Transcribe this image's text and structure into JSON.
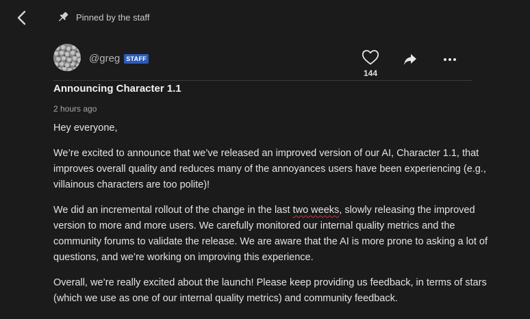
{
  "nav": {
    "back_icon": "chevron-left-icon"
  },
  "pinned": {
    "icon": "pin-icon",
    "label": "Pinned by the staff"
  },
  "author": {
    "username": "@greg",
    "badge": "STAFF"
  },
  "actions": {
    "like_count": "144",
    "like_icon": "heart-icon",
    "share_icon": "share-icon",
    "more_icon": "more-icon"
  },
  "post": {
    "title": "Announcing Character 1.1",
    "timestamp": "2 hours ago",
    "greeting": "Hey everyone,",
    "paragraph1": "We’re excited to announce that we’ve released an improved version of our AI, Character 1.1, that improves overall quality and reduces many of the annoyances users have been experiencing (e.g., villainous characters are too polite)!",
    "paragraph2_before": "We did an incremental rollout of the change in the last ",
    "paragraph2_highlight": "two weeks",
    "paragraph2_after": ", slowly releasing the improved version to more and more users. We carefully monitored our internal quality metrics and the community forums to validate the release. We are aware that the AI is more prone to asking a lot of questions, and we’re working on improving this experience.",
    "paragraph3": "Overall, we’re really excited about the launch! Please keep providing us feedback, in terms of stars (which we use as one of our internal quality metrics) and community feedback."
  },
  "colors": {
    "background": "#1b1b1b",
    "badge": "#2d5ab8",
    "spellcheck": "#d93030"
  }
}
